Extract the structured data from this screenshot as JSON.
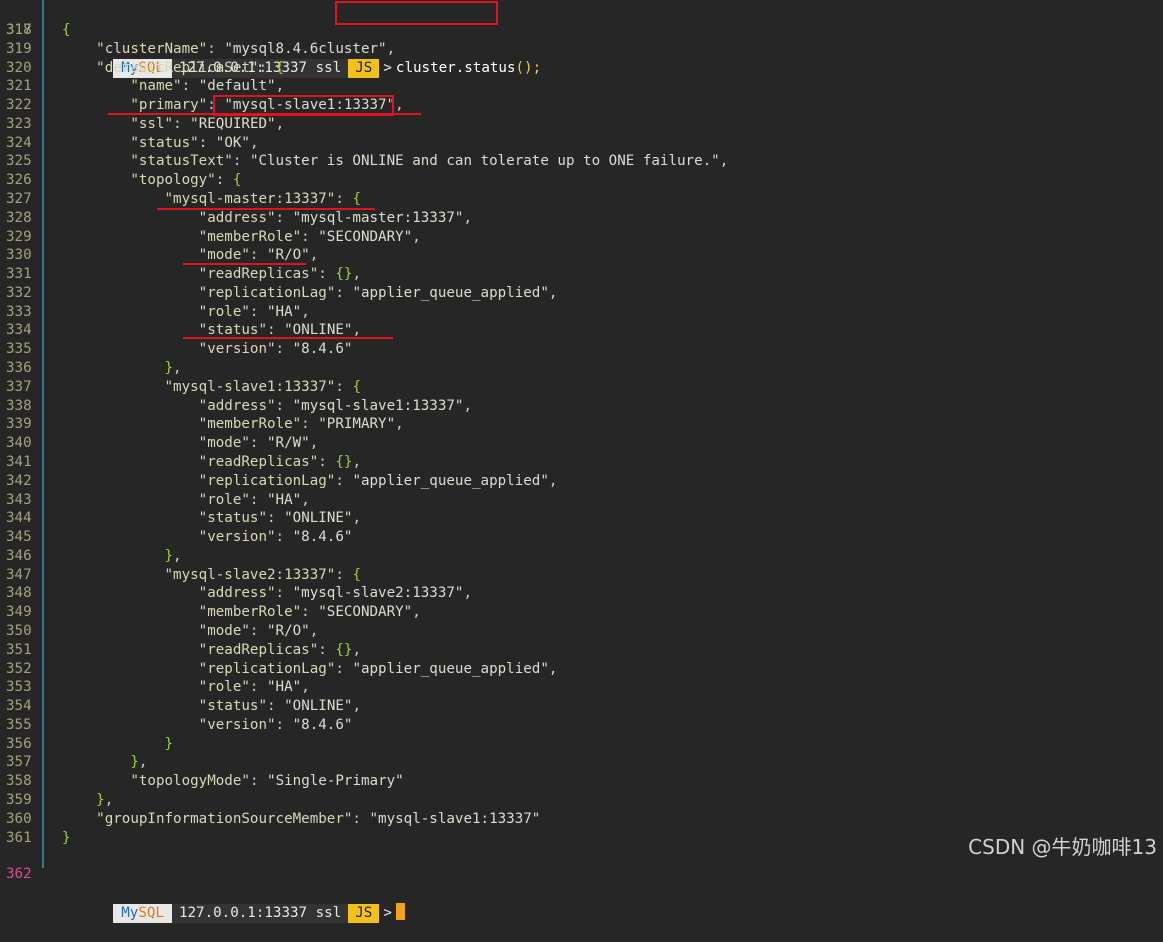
{
  "prompt": {
    "my": "My",
    "sql": "SQL",
    "host": "127.0.0.1:13337 ssl",
    "mode": "JS",
    "arrow": ">"
  },
  "command": {
    "object": "cluster",
    "dot": ".",
    "method": "status",
    "call": "();"
  },
  "lines": [
    {
      "n": "318",
      "t": [
        [
          "brace",
          "{"
        ]
      ]
    },
    {
      "n": "319",
      "t": [
        [
          "plain",
          "    "
        ],
        [
          "key",
          "\"clusterName\""
        ],
        [
          "punct",
          ": "
        ],
        [
          "str",
          "\"mysql8.4.6cluster\""
        ],
        [
          "punct",
          ","
        ]
      ]
    },
    {
      "n": "320",
      "t": [
        [
          "plain",
          "    "
        ],
        [
          "key",
          "\"defaultReplicaSet\""
        ],
        [
          "punct",
          ": "
        ],
        [
          "brace",
          "{"
        ]
      ]
    },
    {
      "n": "321",
      "t": [
        [
          "plain",
          "        "
        ],
        [
          "key",
          "\"name\""
        ],
        [
          "punct",
          ": "
        ],
        [
          "str",
          "\"default\""
        ],
        [
          "punct",
          ","
        ]
      ]
    },
    {
      "n": "322",
      "t": [
        [
          "plain",
          "        "
        ],
        [
          "key",
          "\"primary\""
        ],
        [
          "punct",
          ": "
        ],
        [
          "str",
          "\"mysql-slave1:13337\""
        ],
        [
          "punct",
          ","
        ]
      ]
    },
    {
      "n": "323",
      "t": [
        [
          "plain",
          "        "
        ],
        [
          "key",
          "\"ssl\""
        ],
        [
          "punct",
          ": "
        ],
        [
          "str",
          "\"REQUIRED\""
        ],
        [
          "punct",
          ","
        ]
      ]
    },
    {
      "n": "324",
      "t": [
        [
          "plain",
          "        "
        ],
        [
          "key",
          "\"status\""
        ],
        [
          "punct",
          ": "
        ],
        [
          "str",
          "\"OK\""
        ],
        [
          "punct",
          ","
        ]
      ]
    },
    {
      "n": "325",
      "t": [
        [
          "plain",
          "        "
        ],
        [
          "key",
          "\"statusText\""
        ],
        [
          "punct",
          ": "
        ],
        [
          "str",
          "\"Cluster is ONLINE and can tolerate up to ONE failure.\""
        ],
        [
          "punct",
          ","
        ]
      ]
    },
    {
      "n": "326",
      "t": [
        [
          "plain",
          "        "
        ],
        [
          "key",
          "\"topology\""
        ],
        [
          "punct",
          ": "
        ],
        [
          "brace",
          "{"
        ]
      ]
    },
    {
      "n": "327",
      "t": [
        [
          "plain",
          "            "
        ],
        [
          "key",
          "\"mysql-master:13337\""
        ],
        [
          "punct",
          ": "
        ],
        [
          "brace",
          "{"
        ]
      ]
    },
    {
      "n": "328",
      "t": [
        [
          "plain",
          "                "
        ],
        [
          "key",
          "\"address\""
        ],
        [
          "punct",
          ": "
        ],
        [
          "str",
          "\"mysql-master:13337\""
        ],
        [
          "punct",
          ","
        ]
      ]
    },
    {
      "n": "329",
      "t": [
        [
          "plain",
          "                "
        ],
        [
          "key",
          "\"memberRole\""
        ],
        [
          "punct",
          ": "
        ],
        [
          "str",
          "\"SECONDARY\""
        ],
        [
          "punct",
          ","
        ]
      ]
    },
    {
      "n": "330",
      "t": [
        [
          "plain",
          "                "
        ],
        [
          "key",
          "\"mode\""
        ],
        [
          "punct",
          ": "
        ],
        [
          "str",
          "\"R/O\""
        ],
        [
          "punct",
          ","
        ]
      ]
    },
    {
      "n": "331",
      "t": [
        [
          "plain",
          "                "
        ],
        [
          "key",
          "\"readReplicas\""
        ],
        [
          "punct",
          ": "
        ],
        [
          "brace",
          "{}"
        ],
        [
          "punct",
          ","
        ]
      ]
    },
    {
      "n": "332",
      "t": [
        [
          "plain",
          "                "
        ],
        [
          "key",
          "\"replicationLag\""
        ],
        [
          "punct",
          ": "
        ],
        [
          "str",
          "\"applier_queue_applied\""
        ],
        [
          "punct",
          ","
        ]
      ]
    },
    {
      "n": "333",
      "t": [
        [
          "plain",
          "                "
        ],
        [
          "key",
          "\"role\""
        ],
        [
          "punct",
          ": "
        ],
        [
          "str",
          "\"HA\""
        ],
        [
          "punct",
          ","
        ]
      ]
    },
    {
      "n": "334",
      "t": [
        [
          "plain",
          "                "
        ],
        [
          "key",
          "\"status\""
        ],
        [
          "punct",
          ": "
        ],
        [
          "str",
          "\"ONLINE\""
        ],
        [
          "punct",
          ","
        ]
      ]
    },
    {
      "n": "335",
      "t": [
        [
          "plain",
          "                "
        ],
        [
          "key",
          "\"version\""
        ],
        [
          "punct",
          ": "
        ],
        [
          "str",
          "\"8.4.6\""
        ]
      ]
    },
    {
      "n": "336",
      "t": [
        [
          "plain",
          "            "
        ],
        [
          "brace",
          "}"
        ],
        [
          "punct",
          ","
        ]
      ]
    },
    {
      "n": "337",
      "t": [
        [
          "plain",
          "            "
        ],
        [
          "key",
          "\"mysql-slave1:13337\""
        ],
        [
          "punct",
          ": "
        ],
        [
          "brace",
          "{"
        ]
      ]
    },
    {
      "n": "338",
      "t": [
        [
          "plain",
          "                "
        ],
        [
          "key",
          "\"address\""
        ],
        [
          "punct",
          ": "
        ],
        [
          "str",
          "\"mysql-slave1:13337\""
        ],
        [
          "punct",
          ","
        ]
      ]
    },
    {
      "n": "339",
      "t": [
        [
          "plain",
          "                "
        ],
        [
          "key",
          "\"memberRole\""
        ],
        [
          "punct",
          ": "
        ],
        [
          "str",
          "\"PRIMARY\""
        ],
        [
          "punct",
          ","
        ]
      ]
    },
    {
      "n": "340",
      "t": [
        [
          "plain",
          "                "
        ],
        [
          "key",
          "\"mode\""
        ],
        [
          "punct",
          ": "
        ],
        [
          "str",
          "\"R/W\""
        ],
        [
          "punct",
          ","
        ]
      ]
    },
    {
      "n": "341",
      "t": [
        [
          "plain",
          "                "
        ],
        [
          "key",
          "\"readReplicas\""
        ],
        [
          "punct",
          ": "
        ],
        [
          "brace",
          "{}"
        ],
        [
          "punct",
          ","
        ]
      ]
    },
    {
      "n": "342",
      "t": [
        [
          "plain",
          "                "
        ],
        [
          "key",
          "\"replicationLag\""
        ],
        [
          "punct",
          ": "
        ],
        [
          "str",
          "\"applier_queue_applied\""
        ],
        [
          "punct",
          ","
        ]
      ]
    },
    {
      "n": "343",
      "t": [
        [
          "plain",
          "                "
        ],
        [
          "key",
          "\"role\""
        ],
        [
          "punct",
          ": "
        ],
        [
          "str",
          "\"HA\""
        ],
        [
          "punct",
          ","
        ]
      ]
    },
    {
      "n": "344",
      "t": [
        [
          "plain",
          "                "
        ],
        [
          "key",
          "\"status\""
        ],
        [
          "punct",
          ": "
        ],
        [
          "str",
          "\"ONLINE\""
        ],
        [
          "punct",
          ","
        ]
      ]
    },
    {
      "n": "345",
      "t": [
        [
          "plain",
          "                "
        ],
        [
          "key",
          "\"version\""
        ],
        [
          "punct",
          ": "
        ],
        [
          "str",
          "\"8.4.6\""
        ]
      ]
    },
    {
      "n": "346",
      "t": [
        [
          "plain",
          "            "
        ],
        [
          "brace",
          "}"
        ],
        [
          "punct",
          ","
        ]
      ]
    },
    {
      "n": "347",
      "t": [
        [
          "plain",
          "            "
        ],
        [
          "key",
          "\"mysql-slave2:13337\""
        ],
        [
          "punct",
          ": "
        ],
        [
          "brace",
          "{"
        ]
      ]
    },
    {
      "n": "348",
      "t": [
        [
          "plain",
          "                "
        ],
        [
          "key",
          "\"address\""
        ],
        [
          "punct",
          ": "
        ],
        [
          "str",
          "\"mysql-slave2:13337\""
        ],
        [
          "punct",
          ","
        ]
      ]
    },
    {
      "n": "349",
      "t": [
        [
          "plain",
          "                "
        ],
        [
          "key",
          "\"memberRole\""
        ],
        [
          "punct",
          ": "
        ],
        [
          "str",
          "\"SECONDARY\""
        ],
        [
          "punct",
          ","
        ]
      ]
    },
    {
      "n": "350",
      "t": [
        [
          "plain",
          "                "
        ],
        [
          "key",
          "\"mode\""
        ],
        [
          "punct",
          ": "
        ],
        [
          "str",
          "\"R/O\""
        ],
        [
          "punct",
          ","
        ]
      ]
    },
    {
      "n": "351",
      "t": [
        [
          "plain",
          "                "
        ],
        [
          "key",
          "\"readReplicas\""
        ],
        [
          "punct",
          ": "
        ],
        [
          "brace",
          "{}"
        ],
        [
          "punct",
          ","
        ]
      ]
    },
    {
      "n": "352",
      "t": [
        [
          "plain",
          "                "
        ],
        [
          "key",
          "\"replicationLag\""
        ],
        [
          "punct",
          ": "
        ],
        [
          "str",
          "\"applier_queue_applied\""
        ],
        [
          "punct",
          ","
        ]
      ]
    },
    {
      "n": "353",
      "t": [
        [
          "plain",
          "                "
        ],
        [
          "key",
          "\"role\""
        ],
        [
          "punct",
          ": "
        ],
        [
          "str",
          "\"HA\""
        ],
        [
          "punct",
          ","
        ]
      ]
    },
    {
      "n": "354",
      "t": [
        [
          "plain",
          "                "
        ],
        [
          "key",
          "\"status\""
        ],
        [
          "punct",
          ": "
        ],
        [
          "str",
          "\"ONLINE\""
        ],
        [
          "punct",
          ","
        ]
      ]
    },
    {
      "n": "355",
      "t": [
        [
          "plain",
          "                "
        ],
        [
          "key",
          "\"version\""
        ],
        [
          "punct",
          ": "
        ],
        [
          "str",
          "\"8.4.6\""
        ]
      ]
    },
    {
      "n": "356",
      "t": [
        [
          "plain",
          "            "
        ],
        [
          "brace",
          "}"
        ]
      ]
    },
    {
      "n": "357",
      "t": [
        [
          "plain",
          "        "
        ],
        [
          "brace",
          "}"
        ],
        [
          "punct",
          ","
        ]
      ]
    },
    {
      "n": "358",
      "t": [
        [
          "plain",
          "        "
        ],
        [
          "key",
          "\"topologyMode\""
        ],
        [
          "punct",
          ": "
        ],
        [
          "str",
          "\"Single-Primary\""
        ]
      ]
    },
    {
      "n": "359",
      "t": [
        [
          "plain",
          "    "
        ],
        [
          "brace",
          "}"
        ],
        [
          "punct",
          ","
        ]
      ]
    },
    {
      "n": "360",
      "t": [
        [
          "plain",
          "    "
        ],
        [
          "key",
          "\"groupInformationSourceMember\""
        ],
        [
          "punct",
          ": "
        ],
        [
          "str",
          "\"mysql-slave1:13337\""
        ]
      ]
    },
    {
      "n": "361",
      "t": [
        [
          "brace",
          "}"
        ]
      ]
    }
  ],
  "prompt_line_number": "317",
  "current_line_number": "362",
  "watermark": "CSDN @牛奶咖啡13",
  "colors": {
    "background": "#262626",
    "annotation_red": "#e0141e",
    "js_badge": "#f2c21a",
    "mysql_blue": "#1f6fb3",
    "mysql_orange": "#e07b12",
    "cursor": "#f0a21a"
  }
}
